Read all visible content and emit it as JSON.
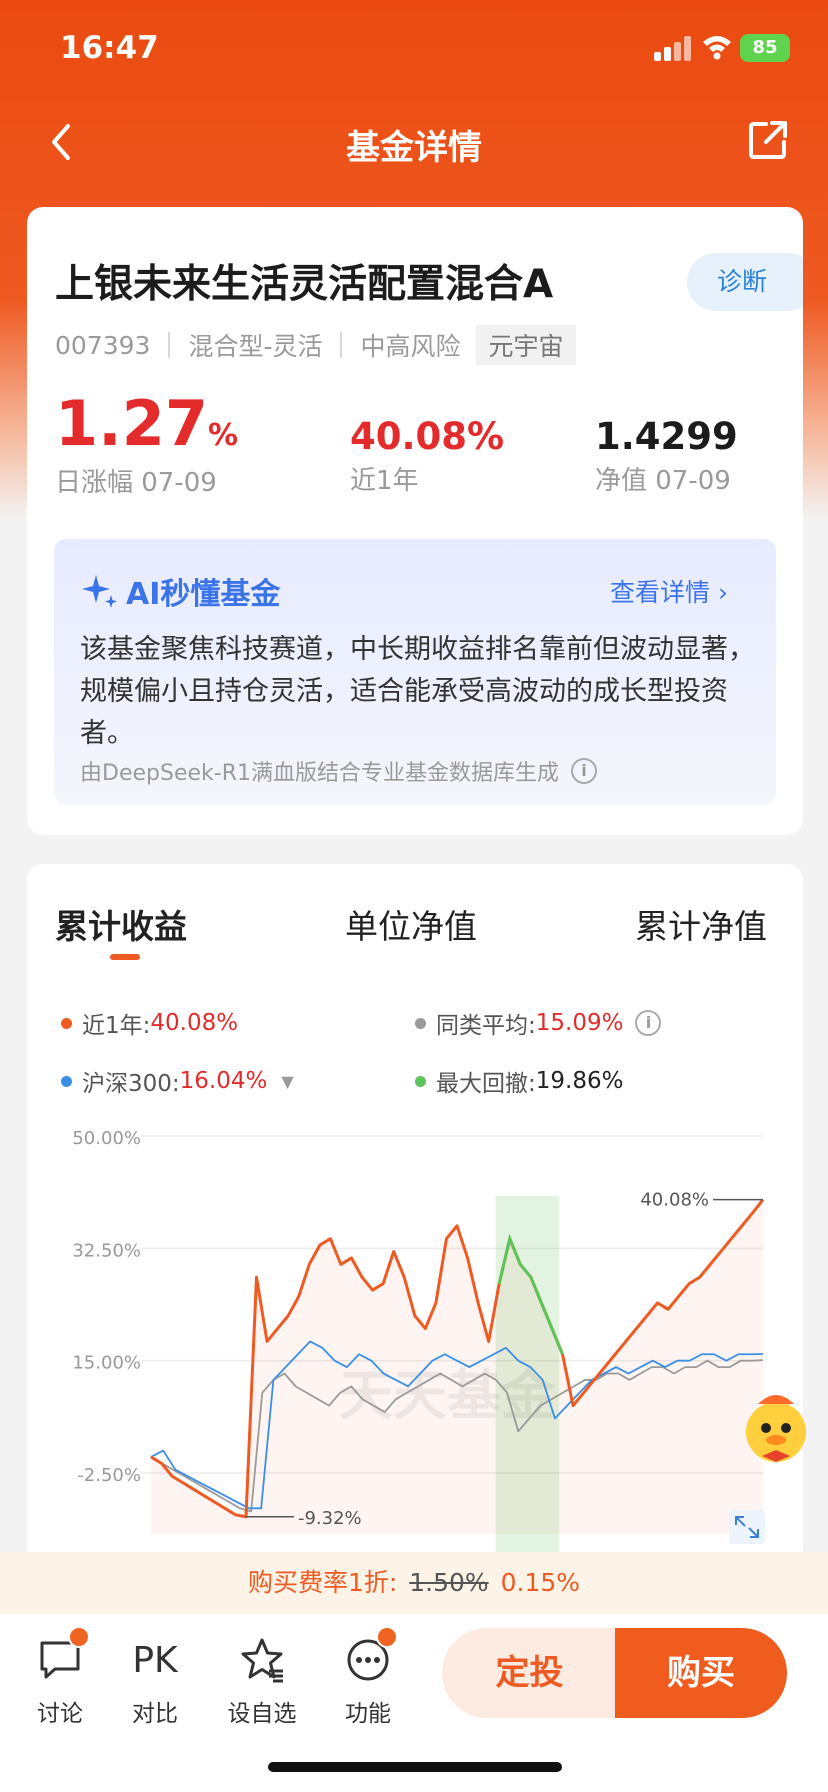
{
  "status_bar": {
    "time": "16:47",
    "battery": "85"
  },
  "nav": {
    "title": "基金详情"
  },
  "fund": {
    "name": "上银未来生活灵活配置混合A",
    "diagnose_label": "诊断",
    "code": "007393",
    "type": "混合型-灵活",
    "risk": "中高风险",
    "tag": "元宇宙",
    "daily_change": "1.27",
    "daily_change_unit": "%",
    "daily_change_label": "日涨幅 07-09",
    "year_return": "40.08%",
    "year_return_label": "近1年",
    "nav_value": "1.4299",
    "nav_label": "净值 07-09"
  },
  "ai": {
    "title": "AI秒懂基金",
    "more": "查看详情",
    "summary": "该基金聚焦科技赛道，中长期收益排名靠前但波动显著，规模偏小且持仓灵活，适合能承受高波动的成长型投资者。",
    "note": "由DeepSeek-R1满血版结合专业基金数据库生成"
  },
  "chart_tabs": [
    "累计收益",
    "单位净值",
    "累计净值"
  ],
  "legend": [
    {
      "label": "近1年: ",
      "value": "40.08%",
      "color": "#ee5a22"
    },
    {
      "label": "同类平均: ",
      "value": "15.09%",
      "color": "#9a9a9a"
    },
    {
      "label": "沪深300: ",
      "value": "16.04%",
      "color": "#3a8ee6"
    },
    {
      "label": "最大回撤: ",
      "value": "19.86%",
      "color": "#5cc45a"
    }
  ],
  "chart_data": {
    "type": "line",
    "y_ticks": [
      "50.00%",
      "32.50%",
      "15.00%",
      "-2.50%"
    ],
    "ylim": [
      -12,
      50
    ],
    "watermark": "天天基金",
    "annotations": {
      "max": "40.08%",
      "min": "-9.32%"
    },
    "series": [
      {
        "name": "近1年",
        "color": "#ee5a22",
        "values": [
          0,
          -1,
          -3,
          -4,
          -5,
          -6,
          -7,
          -8,
          -9,
          -9.32,
          28,
          18,
          20,
          22,
          25,
          30,
          33,
          34,
          30,
          31,
          28,
          26,
          27,
          32,
          28,
          22,
          20,
          24,
          34,
          36,
          31,
          24,
          18,
          27,
          34,
          30,
          28,
          24,
          20,
          16,
          8,
          10,
          12,
          14,
          16,
          18,
          20,
          22,
          24,
          23,
          25,
          27,
          28,
          30,
          32,
          34,
          36,
          38,
          40.08
        ]
      },
      {
        "name": "同类平均",
        "color": "#9a9a9a",
        "values": [
          0,
          -1,
          -2,
          -3,
          -4,
          -5,
          -6,
          -7,
          -8,
          -8.5,
          10,
          12,
          13,
          11,
          10,
          9,
          8,
          10,
          11,
          9,
          8,
          7,
          9,
          10,
          11,
          12,
          13,
          12,
          11,
          12,
          13,
          12,
          10,
          4,
          6,
          8,
          9,
          10,
          11,
          12,
          12,
          13,
          13,
          12,
          13,
          14,
          14,
          13,
          14,
          14,
          15,
          14,
          14,
          15,
          15,
          15.09
        ]
      },
      {
        "name": "沪深300",
        "color": "#3a8ee6",
        "values": [
          0,
          1,
          -2,
          -3,
          -4,
          -5,
          -6,
          -7,
          -8,
          -8,
          12,
          14,
          16,
          18,
          17,
          15,
          14,
          16,
          15,
          13,
          12,
          11,
          13,
          15,
          16,
          15,
          14,
          15,
          16,
          17,
          15,
          14,
          12,
          6,
          8,
          10,
          12,
          13,
          14,
          13,
          14,
          15,
          14,
          15,
          15,
          16,
          16,
          15,
          16,
          16,
          16.04
        ]
      }
    ],
    "drawdown_range": [
      0.563,
      0.667
    ]
  },
  "fee": {
    "prefix": "购买费率1折: ",
    "old": "1.50%",
    "new": "0.15%"
  },
  "bottom": {
    "discuss": "讨论",
    "pk": "PK",
    "compare": "对比",
    "watch": "设自选",
    "func": "功能",
    "invest": "定投",
    "buy": "购买"
  }
}
